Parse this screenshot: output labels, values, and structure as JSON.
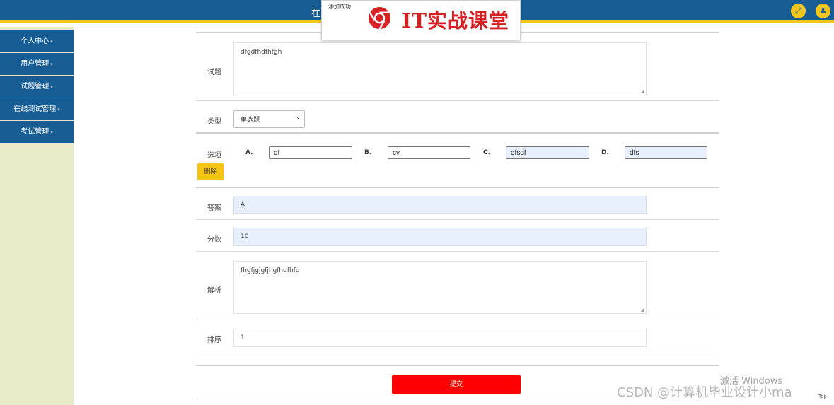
{
  "header": {
    "title_fragment": "在",
    "fullscreen_icon": "expand-icon",
    "user_icon": "user-icon",
    "accent": "#f3c61c",
    "bar_color": "#175c93"
  },
  "sidebar": {
    "items": [
      {
        "label": "个人中心"
      },
      {
        "label": "用户管理"
      },
      {
        "label": "试题管理"
      },
      {
        "label": "在线测试管理"
      },
      {
        "label": "考试管理"
      }
    ]
  },
  "popup": {
    "message": "添加成功",
    "logo_text": "IT实战课堂"
  },
  "form": {
    "question_label": "试题",
    "question_value": "dfgdfhdfhfgh",
    "type_label": "类型",
    "type_value": "单选题",
    "options_label": "选项",
    "options": [
      {
        "letter": "A.",
        "value": "df"
      },
      {
        "letter": "B.",
        "value": "cv"
      },
      {
        "letter": "C.",
        "value": "dfsdf"
      },
      {
        "letter": "D.",
        "value": "dfs"
      }
    ],
    "delete_label": "删除",
    "answer_label": "答案",
    "answer_value": "A",
    "score_label": "分数",
    "score_value": "10",
    "analysis_label": "解析",
    "analysis_value": "fhgfjgjgfjhgfhdfhfd",
    "sort_label": "排序",
    "sort_value": "1",
    "submit_label": "提交"
  },
  "overlay": {
    "csdn_watermark": "CSDN @计算机毕业设计小ma",
    "windows_activation": "激活 Windows",
    "top_button": "Top"
  }
}
